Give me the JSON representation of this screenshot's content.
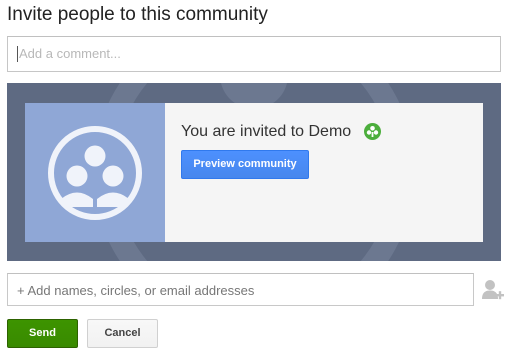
{
  "dialog": {
    "title": "Invite people to this community"
  },
  "comment": {
    "placeholder": "Add a comment...",
    "value": ""
  },
  "preview_card": {
    "invite_text": "You are invited to Demo",
    "preview_button_label": "Preview community",
    "community_icon": "community-people-icon",
    "badge_icon": "community-badge-icon",
    "colors": {
      "panel_background": "#5e6a82",
      "thumbnail_background": "#8fa7d6",
      "card_background": "#f5f5f5",
      "badge_green": "#4cae3c",
      "button_blue": "#4d90fe"
    }
  },
  "recipients": {
    "placeholder": "+ Add names, circles, or email addresses",
    "value": "",
    "add_icon": "add-person-icon"
  },
  "actions": {
    "send_label": "Send",
    "cancel_label": "Cancel",
    "colors": {
      "send_green": "#3d9400",
      "cancel_gray": "#f5f5f5"
    }
  }
}
